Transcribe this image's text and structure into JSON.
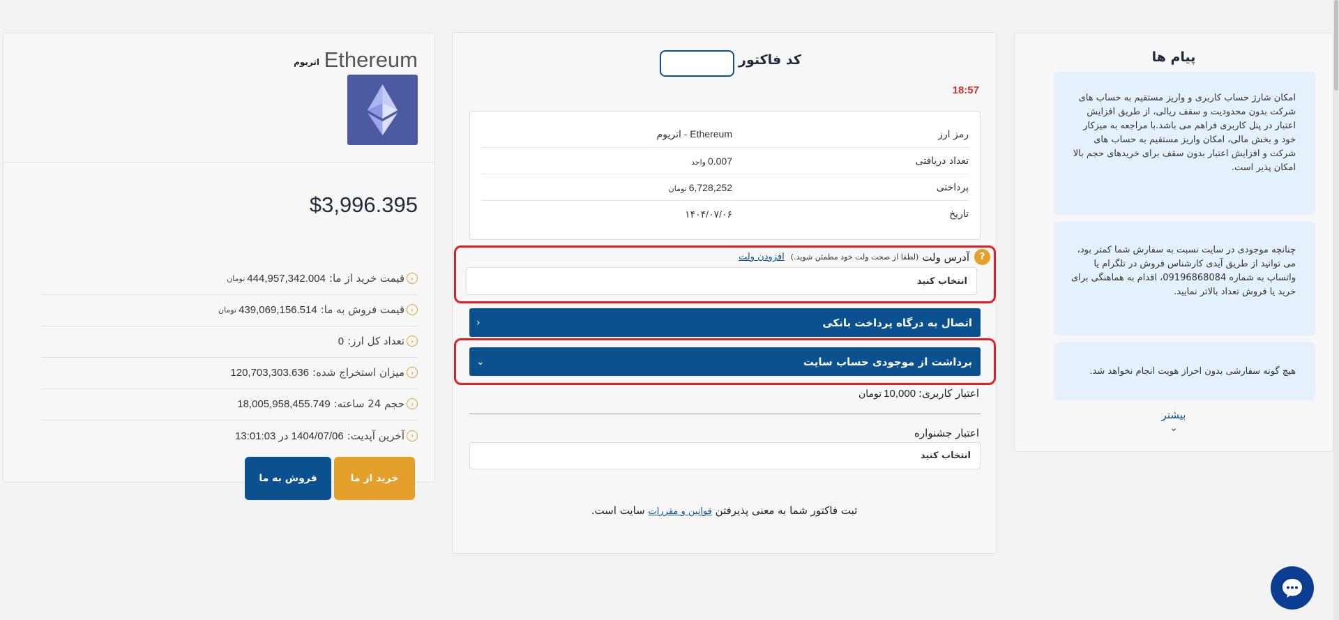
{
  "coin": {
    "name_en": "Ethereum",
    "name_fa": "اتریوم",
    "price_usd": "$3,996.395",
    "stats": [
      {
        "label": "قیمت خرید از ما:",
        "value": "444,957,342.004",
        "unit": "تومان"
      },
      {
        "label": "قیمت فروش به ما:",
        "value": "439,069,156.514",
        "unit": "تومان"
      },
      {
        "label": "تعداد کل ارز:",
        "value": "0",
        "unit": ""
      },
      {
        "label": "میزان استخراج شده:",
        "value": "120,703,303.636",
        "unit": ""
      },
      {
        "label": "حجم 24 ساعته:",
        "value": "18,005,958,455.749",
        "unit": ""
      },
      {
        "label": "آخرین آپدیت:",
        "value": "1404/07/06 در 13:01:03",
        "unit": ""
      }
    ],
    "buy_label": "خرید از ما",
    "sell_label": "فروش به ما",
    "stat_icon": "chevron-left-circle-icon",
    "accent_color": "#e59f2b"
  },
  "invoice": {
    "title": "کد فاکتور",
    "code": "",
    "timer": "18:57",
    "summary": [
      {
        "label": "رمز ارز",
        "value": "Ethereum - اتریوم",
        "unit": ""
      },
      {
        "label": "تعداد دریافتی",
        "value": "0.007",
        "unit": "واحد"
      },
      {
        "label": "پرداختی",
        "value": "6,728,252",
        "unit": "تومان"
      },
      {
        "label": "تاریخ",
        "value": "۱۴۰۴/۰۷/۰۶",
        "unit": ""
      }
    ],
    "wallet_label": "آدرس ولت",
    "wallet_hint": "(لطفا از صحت ولت خود مطمئن شوید.)",
    "add_wallet": "افزودن ولت",
    "wallet_placeholder": "انتخاب کنید",
    "gateway_label": "اتصال به درگاه پرداخت بانکی",
    "wallet_pay_label": "برداشت از موجودی حساب سایت",
    "user_credit_label": "اعتبار کاربری:",
    "user_credit_value": "10,000",
    "user_credit_unit": "تومان",
    "festival_label": "اعتبار جشنواره",
    "festival_placeholder": "انتخاب کنید",
    "terms_prefix": "ثبت فاکتور شما به معنی پذیرفتن",
    "terms_link": "قوانین و مقررات",
    "terms_suffix": "سایت است.",
    "primary_color": "#0b5190",
    "highlight_color": "#e31e25"
  },
  "messages": {
    "title": "پیام ها",
    "items": [
      "امکان شارژ حساب کاربری و واریز مستقیم به حساب های شرکت بدون محدودیت و سقف ریالی، از طریق افزایش اعتبار در پنل کاربری فراهم می باشد.با مراجعه به میزکار خود و بخش مالی، امکان واریز مستقیم به حساب های شرکت و افزایش اعتبار بدون سقف برای خریدهای حجم بالا امکان پذیر است.",
      "چنانچه موجودی در سایت نسبت به سفارش شما کمتر بود، می توانید از طریق آیدی کارشناس فروش در تلگرام یا واتساپ به شماره 09196868084، اقدام به هماهنگی برای خرید یا فروش تعداد بالاتر نمایید.",
      "هیچ گونه سفارشی بدون احراز هویت انجام نخواهد شد."
    ],
    "more_label": "بیشتر"
  },
  "chat": {
    "icon": "chat-bubble-icon"
  }
}
